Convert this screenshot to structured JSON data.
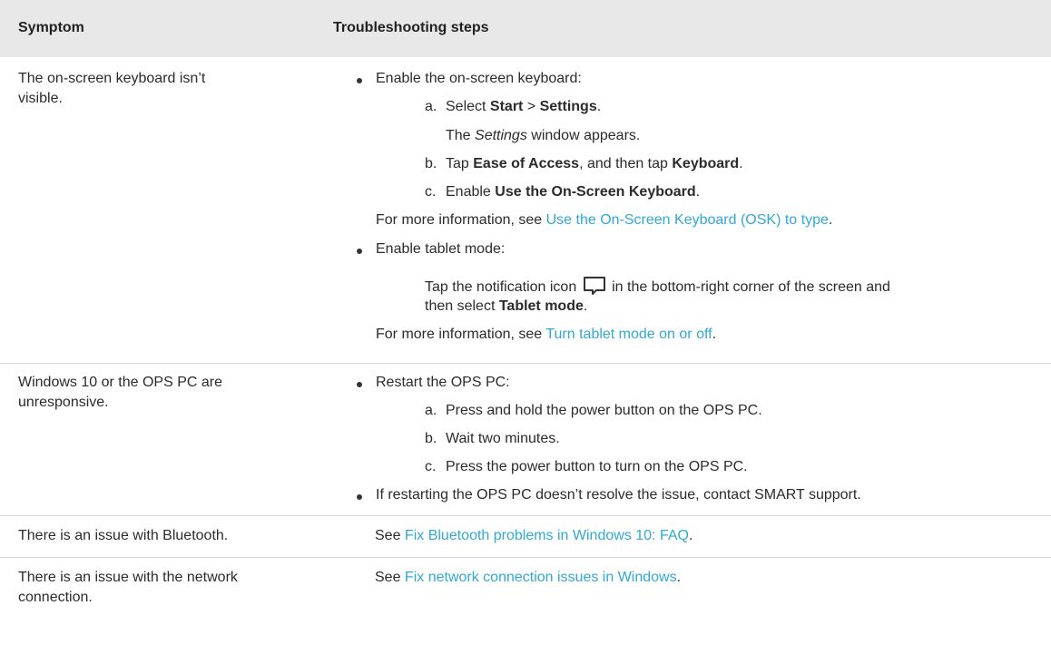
{
  "header": {
    "symptom": "Symptom",
    "steps": "Troubleshooting steps"
  },
  "row1": {
    "symptom_line1": "The on-screen keyboard isn’t",
    "symptom_line2": "visible.",
    "b1": "Enable the on-screen keyboard:",
    "a_prefix": "a.",
    "a_text": "Select ",
    "a_start": "Start",
    "a_sep": " > ",
    "a_settings": "Settings",
    "a_end": ".",
    "a_note_em": "Settings",
    "a_note_rest": " window appears.",
    "a_note_pre": "The ",
    "b_prefix": "b.",
    "b_text": "Tap ",
    "b_ease": "Ease of Access",
    "b_mid": ", and then tap ",
    "b_keyboard": "Keyboard",
    "b_end": ".",
    "c_prefix": "c.",
    "c_text": "Enable ",
    "c_use": "Use the On-Screen Keyboard",
    "c_end": ".",
    "more1_pre": "For more information, see ",
    "more1_link": "Use the On-Screen Keyboard (OSK) to type",
    "more1_end": ".",
    "b2": "Enable tablet mode:",
    "tap_pre": "Tap the notification icon ",
    "tap_post": " in the bottom-right corner of the screen and",
    "tap2_pre": "then select ",
    "tap2_bold": "Tablet mode",
    "tap2_end": ".",
    "more2_pre": "For more information, see ",
    "more2_link": "Turn tablet mode on or off",
    "more2_end": "."
  },
  "row2": {
    "symptom_line1": "Windows 10 or the OPS PC are",
    "symptom_line2": "unresponsive.",
    "b1": "Restart the OPS PC:",
    "a_prefix": "a.",
    "a": "Press and hold the power button on the OPS PC.",
    "b_prefix": "b.",
    "b": "Wait two minutes.",
    "c_prefix": "c.",
    "c": "Press the power button to turn on the OPS PC.",
    "b2": "If restarting the OPS PC doesn’t resolve the issue, contact SMART support."
  },
  "row3": {
    "symptom": "There is an issue with Bluetooth.",
    "see_pre": "See ",
    "see_link": "Fix Bluetooth problems in Windows 10: FAQ",
    "see_end": "."
  },
  "row4": {
    "symptom_line1": "There is an issue with the network",
    "symptom_line2": "connection.",
    "see_pre": "See ",
    "see_link": "Fix network connection issues in Windows",
    "see_end": "."
  },
  "colors": {
    "header_bg": "#e8e8e8",
    "link": "#2fa9d6",
    "separator": "#d6d6d6"
  },
  "icons": {
    "notification": "notification-icon"
  }
}
